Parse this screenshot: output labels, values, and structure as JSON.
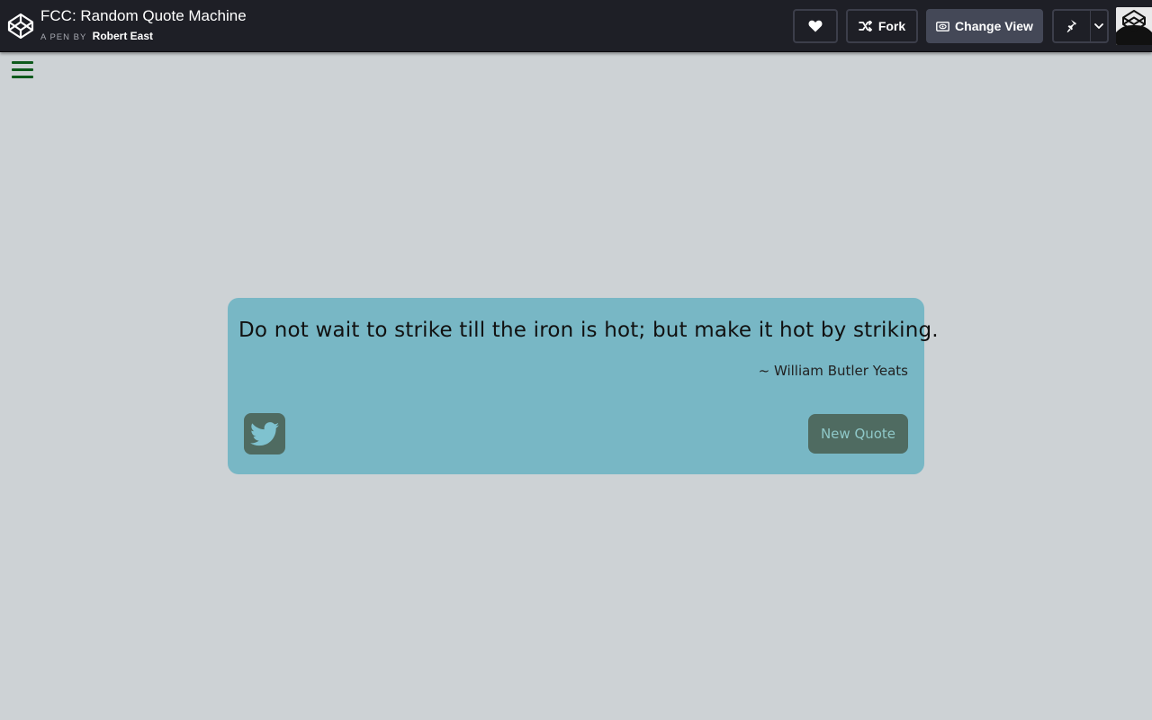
{
  "header": {
    "title": "FCC: Random Quote Machine",
    "by_label": "A PEN BY",
    "author": "Robert East",
    "like_icon": "heart-icon",
    "fork_label": "Fork",
    "fork_icon": "fork-icon",
    "change_view_label": "Change View",
    "change_view_icon": "eye-window-icon",
    "pin_icon": "pin-icon",
    "caret_icon": "chevron-down-icon"
  },
  "menu": {
    "icon": "hamburger-menu-icon"
  },
  "quote": {
    "text": "Do not wait to strike till the iron is hot; but make it hot by striking.",
    "author": "~ William Butler Yeats",
    "tweet_icon": "twitter-icon",
    "new_quote_label": "New Quote"
  },
  "colors": {
    "page_bg": "#cdd2d5",
    "topbar_bg": "#1e1f26",
    "card_bg": "#78b7c5",
    "button_bg": "#4f6b61",
    "button_text": "#8fc8c8",
    "hamburger": "#0e5a1c"
  }
}
